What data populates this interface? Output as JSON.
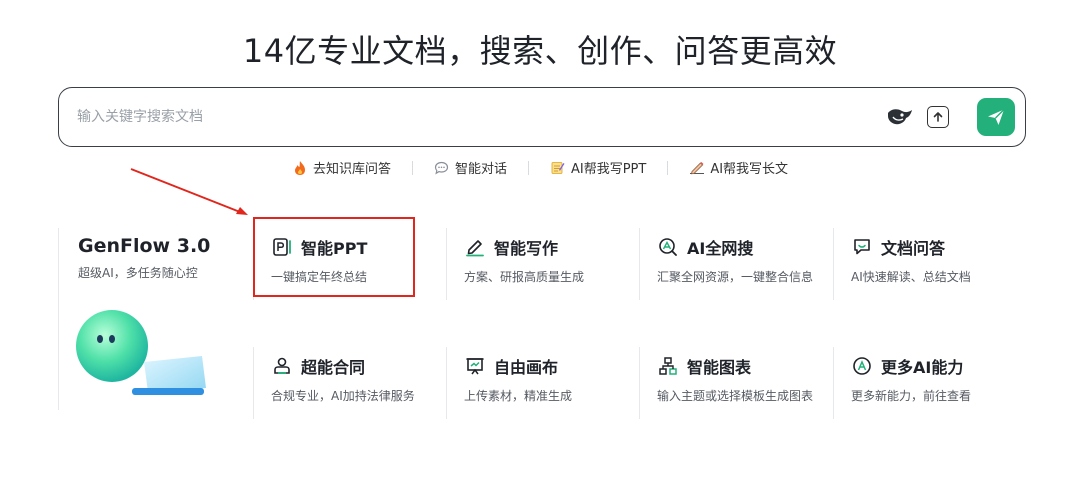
{
  "headline": "14亿专业文档，搜索、创作、问答更高效",
  "search": {
    "placeholder": "输入关键字搜索文档"
  },
  "quick_links": [
    {
      "icon": "fire-icon",
      "label": "去知识库问答"
    },
    {
      "icon": "chat-bubble-icon",
      "label": "智能对话"
    },
    {
      "icon": "notepad-icon",
      "label": "AI帮我写PPT"
    },
    {
      "icon": "pen-icon",
      "label": "AI帮我写长文"
    }
  ],
  "genflow": {
    "title": "GenFlow 3.0",
    "subtitle": "超级AI，多任务随心控"
  },
  "cards": [
    {
      "title": "智能PPT",
      "desc": "一键搞定年终总结",
      "icon": "ppt-icon"
    },
    {
      "title": "智能写作",
      "desc": "方案、研报高质量生成",
      "icon": "pencil-icon"
    },
    {
      "title": "AI全网搜",
      "desc": "汇聚全网资源，一键整合信息",
      "icon": "search-web-icon"
    },
    {
      "title": "文档问答",
      "desc": "AI快速解读、总结文档",
      "icon": "doc-chat-icon"
    },
    {
      "title": "超能合同",
      "desc": "合规专业，AI加持法律服务",
      "icon": "contract-icon"
    },
    {
      "title": "自由画布",
      "desc": "上传素材，精准生成",
      "icon": "canvas-icon"
    },
    {
      "title": "智能图表",
      "desc": "输入主题或选择模板生成图表",
      "icon": "chart-icon"
    },
    {
      "title": "更多AI能力",
      "desc": "更多新能力，前往查看",
      "icon": "more-ai-icon"
    }
  ],
  "colors": {
    "accent": "#23b07a",
    "annotation": "#e0261d"
  }
}
